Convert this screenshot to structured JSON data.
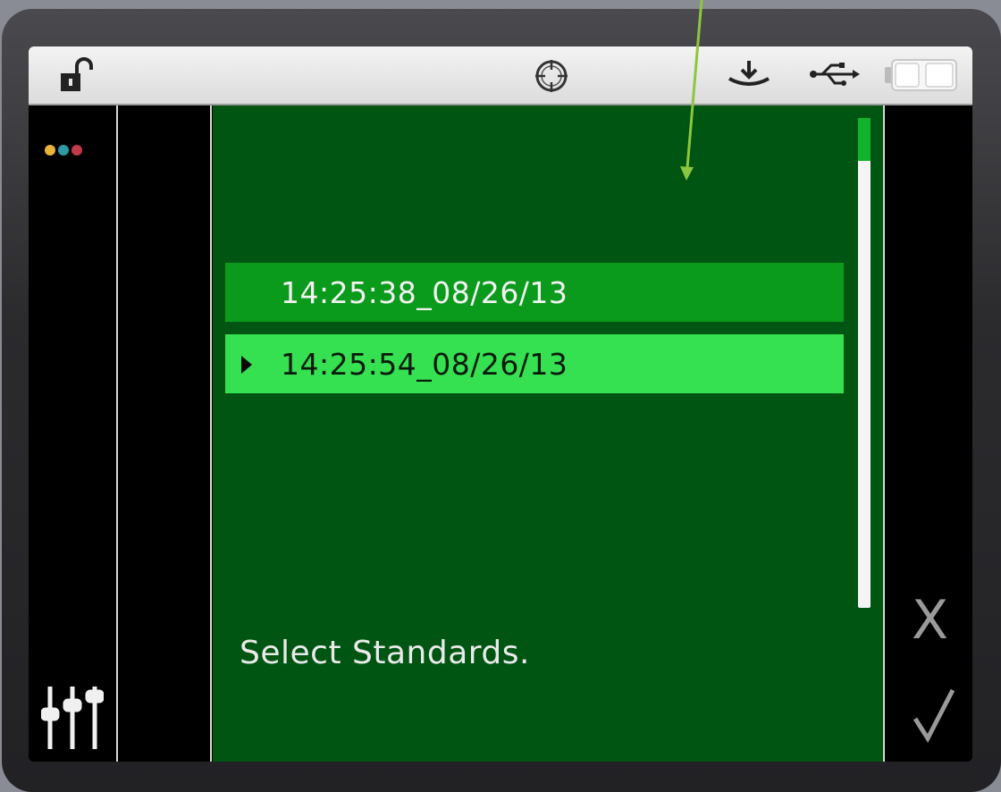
{
  "status_bar": {
    "lock_icon": "unlocked-padlock-icon",
    "target_icon": "crosshair-target-icon",
    "download_icon": "download-tray-icon",
    "usb_icon": "usb-icon",
    "battery_icon": "battery-icon"
  },
  "left_panel": {
    "dots": [
      "#e8b33a",
      "#2f9aa3",
      "#c23a4a"
    ],
    "settings_icon": "sliders-icon"
  },
  "list": {
    "items": [
      {
        "label": "14:25:38_08/26/13",
        "selected": false
      },
      {
        "label": "14:25:54_08/26/13",
        "selected": true
      }
    ]
  },
  "scrollbar": {
    "position": 0.0
  },
  "prompt": "Select Standards.",
  "right_panel": {
    "cancel_label": "X",
    "confirm_icon": "checkmark-icon"
  },
  "colors": {
    "panel": "#005512",
    "row_normal": "#0b9b1c",
    "row_selected": "#35e051",
    "annotation_arrow": "#8dc63f"
  }
}
